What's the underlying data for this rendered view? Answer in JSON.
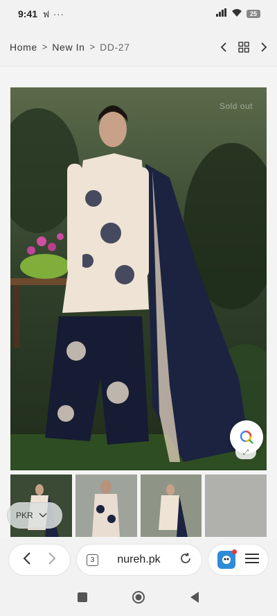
{
  "status_bar": {
    "time": "9:41",
    "left_icons": "ฟ ···",
    "battery": "25",
    "icons": [
      "signal-icon",
      "wifi-icon",
      "battery-icon"
    ]
  },
  "breadcrumb": {
    "items": [
      "Home",
      "New In",
      "DD-27"
    ],
    "separator": ">",
    "nav_icons": [
      "chevron-left-icon",
      "grid-icon",
      "chevron-right-icon"
    ]
  },
  "product": {
    "badge": "Sold out",
    "main_image_icon": "product-photo-icon",
    "thumbnail_count": 4
  },
  "currency": {
    "label": "PKR"
  },
  "browser": {
    "tab_count": "3",
    "url": "nureh.pk",
    "icons": [
      "back-icon",
      "forward-icon",
      "reload-icon",
      "extension-icon",
      "menu-icon"
    ]
  },
  "colors": {
    "accent_dark": "#1c2340",
    "fabric_light": "#efe3d6",
    "foliage": "#2e4a2a",
    "background": "#f2f2f2"
  }
}
